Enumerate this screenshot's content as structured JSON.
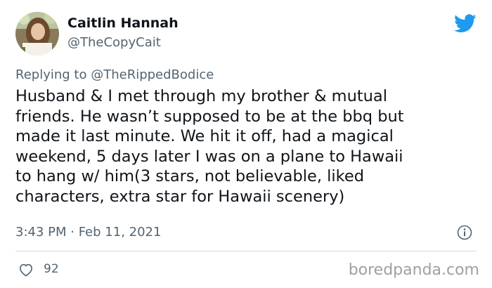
{
  "author": {
    "name": "Caitlin Hannah",
    "handle": "@TheCopyCait",
    "avatar_icon": "profile-photo"
  },
  "brand_icon": "twitter-bird-icon",
  "brand_color": "#1d9bf0",
  "reply": {
    "prefix": "Replying to",
    "to": "@TheRippedBodice"
  },
  "tweet": {
    "lines": [
      "Husband & I met through my brother & mutual",
      "friends. He wasn’t supposed to be at the bbq but",
      "made it last minute. We hit it off, had a magical",
      "weekend, 5 days later I was on a plane to Hawaii",
      "to hang w/ him(3 stars, not believable, liked",
      "characters, extra star for Hawaii scenery)"
    ],
    "timestamp": "3:43 PM · Feb 11, 2021"
  },
  "actions": {
    "like_count": "92",
    "like_icon": "heart-icon",
    "info_icon": "info-icon"
  },
  "watermark": "boredpanda.com"
}
